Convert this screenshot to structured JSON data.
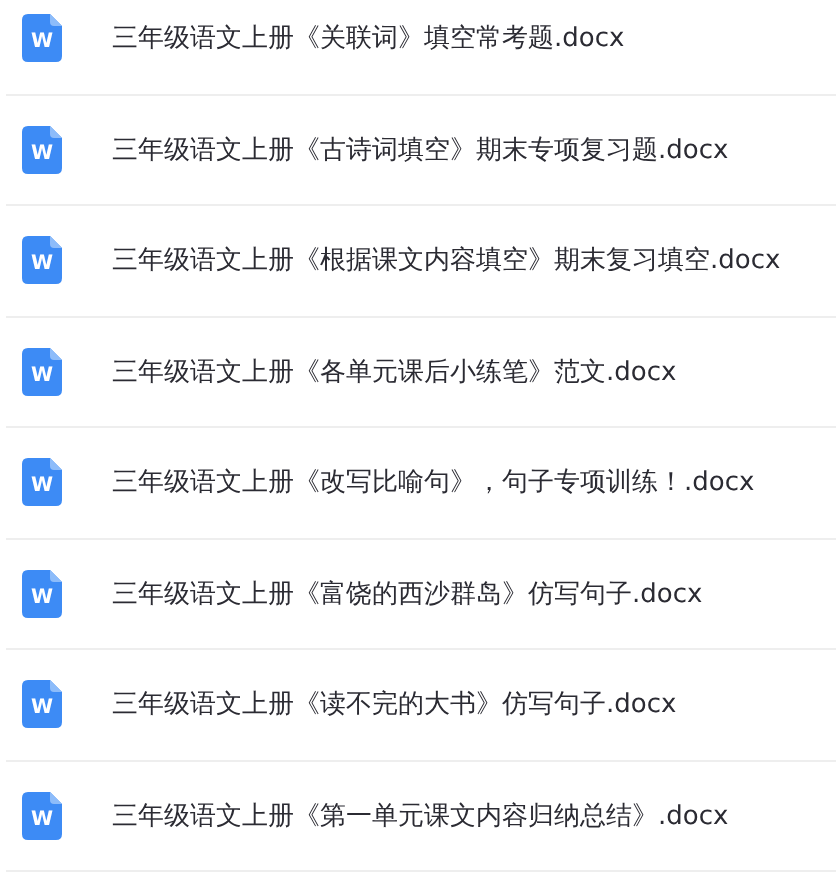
{
  "files": [
    {
      "icon_text": "W",
      "name": "三年级语文上册《关联词》填空常考题.docx"
    },
    {
      "icon_text": "W",
      "name": "三年级语文上册《古诗词填空》期末专项复习题.docx"
    },
    {
      "icon_text": "W",
      "name": "三年级语文上册《根据课文内容填空》期末复习填空.docx"
    },
    {
      "icon_text": "W",
      "name": "三年级语文上册《各单元课后小练笔》范文.docx"
    },
    {
      "icon_text": "W",
      "name": "三年级语文上册《改写比喻句》，句子专项训练！.docx"
    },
    {
      "icon_text": "W",
      "name": "三年级语文上册《富饶的西沙群岛》仿写句子.docx"
    },
    {
      "icon_text": "W",
      "name": "三年级语文上册《读不完的大书》仿写句子.docx"
    },
    {
      "icon_text": "W",
      "name": "三年级语文上册《第一单元课文内容归纳总结》.docx"
    }
  ]
}
